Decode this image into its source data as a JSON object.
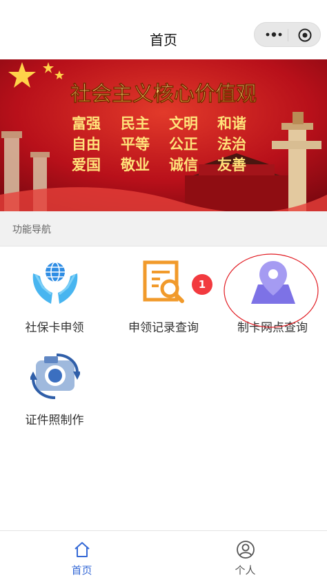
{
  "navbar": {
    "title": "首页"
  },
  "banner": {
    "heading": "社会主义核心价值观",
    "values": [
      [
        "富强",
        "民主",
        "文明",
        "和谐"
      ],
      [
        "自由",
        "平等",
        "公正",
        "法治"
      ],
      [
        "爱国",
        "敬业",
        "诚信",
        "友善"
      ]
    ]
  },
  "section": {
    "label": "功能导航"
  },
  "tiles": [
    {
      "label": "社保卡申领",
      "icon": "hands-globe-icon"
    },
    {
      "label": "申领记录查询",
      "icon": "document-search-icon",
      "badge": "1"
    },
    {
      "label": "制卡网点查询",
      "icon": "map-location-pin-icon"
    },
    {
      "label": "证件照制作",
      "icon": "camera-photo-icon"
    }
  ],
  "tabbar": {
    "items": [
      {
        "label": "首页",
        "icon": "home-icon",
        "active": true
      },
      {
        "label": "个人",
        "icon": "user-profile-icon",
        "active": false
      }
    ]
  },
  "colors": {
    "accent": "#3569d6",
    "badge": "#f23a3f",
    "banner_red": "#c8151a"
  }
}
